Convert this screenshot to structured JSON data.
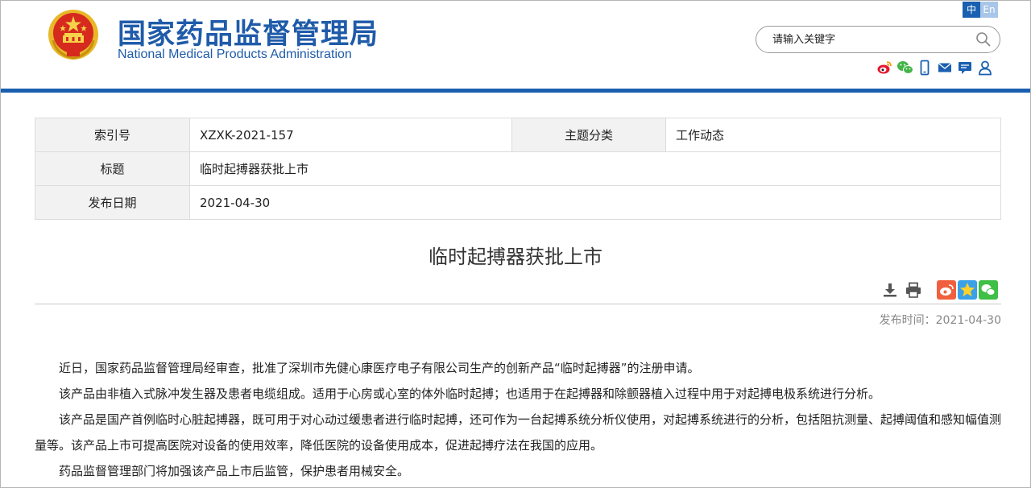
{
  "header": {
    "title_cn": "国家药品监督管理局",
    "title_en": "National Medical Products Administration",
    "lang_cn": "中",
    "lang_en": "En",
    "search_placeholder": "请输入关键字",
    "brand_color": "#1a5fb0",
    "icons": [
      "weibo-icon",
      "wechat-icon",
      "mobile-icon",
      "mail-icon",
      "message-icon",
      "user-icon"
    ]
  },
  "info": {
    "index_label": "索引号",
    "index_value": "XZXK-2021-157",
    "topic_label": "主题分类",
    "topic_value": "工作动态",
    "title_label": "标题",
    "title_value": "临时起搏器获批上市",
    "date_label": "发布日期",
    "date_value": "2021-04-30"
  },
  "article": {
    "title": "临时起搏器获批上市",
    "tools": [
      "download-icon",
      "print-icon"
    ],
    "share": [
      "weibo-share-icon",
      "favorite-icon",
      "wechat-share-icon"
    ],
    "pubdate_label": "发布时间：",
    "pubdate_value": "2021-04-30",
    "paragraphs": [
      "近日，国家药品监督管理局经审查，批准了深圳市先健心康医疗电子有限公司生产的创新产品“临时起搏器”的注册申请。",
      "该产品由非植入式脉冲发生器及患者电缆组成。适用于心房或心室的体外临时起搏；也适用于在起搏器和除颤器植入过程中用于对起搏电极系统进行分析。",
      "该产品是国产首例临时心脏起搏器，既可用于对心动过缓患者进行临时起搏，还可作为一台起搏系统分析仪使用，对起搏系统进行的分析，包括阻抗测量、起搏阈值和感知幅值测量等。该产品上市可提高医院对设备的使用效率，降低医院的设备使用成本，促进起搏疗法在我国的应用。",
      "药品监督管理部门将加强该产品上市后监管，保护患者用械安全。"
    ]
  }
}
